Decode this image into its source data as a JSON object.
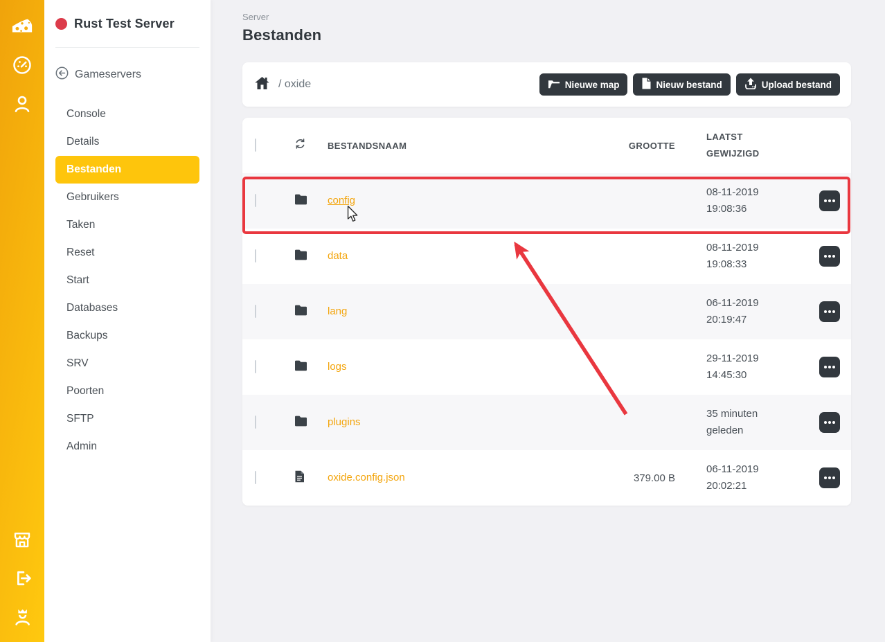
{
  "rail": {
    "icons": [
      "cheese-logo",
      "dashboard-gauge",
      "user-account",
      "store",
      "logout",
      "admin-user"
    ]
  },
  "sidebar": {
    "server_name": "Rust Test Server",
    "back_label": "Gameservers",
    "items": [
      {
        "label": "Console",
        "active": false
      },
      {
        "label": "Details",
        "active": false
      },
      {
        "label": "Bestanden",
        "active": true
      },
      {
        "label": "Gebruikers",
        "active": false
      },
      {
        "label": "Taken",
        "active": false
      },
      {
        "label": "Reset",
        "active": false
      },
      {
        "label": "Start",
        "active": false
      },
      {
        "label": "Databases",
        "active": false
      },
      {
        "label": "Backups",
        "active": false
      },
      {
        "label": "SRV",
        "active": false
      },
      {
        "label": "Poorten",
        "active": false
      },
      {
        "label": "SFTP",
        "active": false
      },
      {
        "label": "Admin",
        "active": false
      }
    ]
  },
  "page": {
    "eyebrow": "Server",
    "title": "Bestanden"
  },
  "toolbar": {
    "path": "/ oxide",
    "new_folder_label": "Nieuwe map",
    "new_file_label": "Nieuw bestand",
    "upload_label": "Upload bestand"
  },
  "table": {
    "headers": {
      "name": "BESTANDSNAAM",
      "size": "GROOTTE",
      "modified": "LAATST GEWIJZIGD"
    },
    "rows": [
      {
        "name": "config",
        "type": "folder",
        "size": "",
        "modified_date": "08-11-2019",
        "modified_time": "19:08:36"
      },
      {
        "name": "data",
        "type": "folder",
        "size": "",
        "modified_date": "08-11-2019",
        "modified_time": "19:08:33"
      },
      {
        "name": "lang",
        "type": "folder",
        "size": "",
        "modified_date": "06-11-2019",
        "modified_time": "20:19:47"
      },
      {
        "name": "logs",
        "type": "folder",
        "size": "",
        "modified_date": "29-11-2019",
        "modified_time": "14:45:30"
      },
      {
        "name": "plugins",
        "type": "folder",
        "size": "",
        "modified_date": "35 minuten",
        "modified_time": "geleden"
      },
      {
        "name": "oxide.config.json",
        "type": "file",
        "size": "379.00 B",
        "modified_date": "06-11-2019",
        "modified_time": "20:02:21"
      }
    ]
  },
  "colors": {
    "accent_yellow": "#fec50c",
    "rail_gradient": [
      "#f0a30b",
      "#ffc90f"
    ],
    "dark_button": "#32383e",
    "file_link": "#f3a50d",
    "annotation_red": "#e9373f",
    "status_dot_red": "#dc3b4a"
  }
}
